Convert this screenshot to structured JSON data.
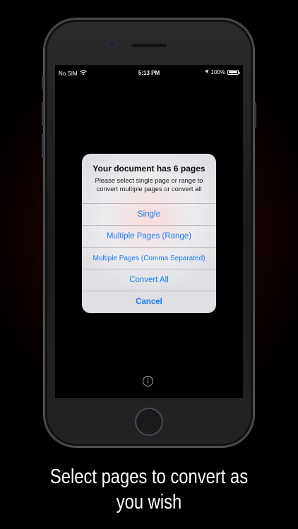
{
  "status_bar": {
    "carrier": "No SIM",
    "time": "5:13 PM",
    "battery": "100%",
    "battery_level": 1.0
  },
  "alert": {
    "title": "Your document has 6 pages",
    "message": "Please select single page or range to convert multiple pages or convert all",
    "buttons": [
      {
        "label": "Single"
      },
      {
        "label": "Multiple Pages (Range)"
      },
      {
        "label": "Multiple Pages (Comma Separated)"
      },
      {
        "label": "Convert All"
      },
      {
        "label": "Cancel"
      }
    ]
  },
  "info_icon": "info-icon",
  "caption": {
    "line1": "Select pages to convert as",
    "line2": "you wish"
  },
  "colors": {
    "accent": "#1a7bf2",
    "background": "#000000"
  }
}
